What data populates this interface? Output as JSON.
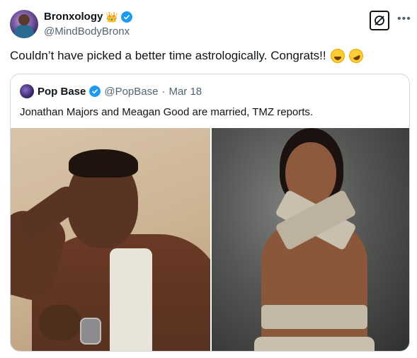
{
  "author": {
    "name": "Bronxology",
    "handle": "@MindBodyBronx",
    "crown_emoji": "👑",
    "verified": true
  },
  "tweet": {
    "text": "Couldn’t have picked a better time astrologically. Congrats!!",
    "emojis": [
      "grinning-sweat",
      "rolling-on-floor-laughing"
    ]
  },
  "quoted": {
    "name": "Pop Base",
    "handle": "@PopBase",
    "separator": "·",
    "date": "Mar 18",
    "verified": true,
    "text": "Jonathan Majors and Meagan Good are married, TMZ reports."
  },
  "colors": {
    "verified": "#1d9bf0",
    "text": "#0f1419",
    "secondary": "#536471",
    "border": "#cfd9de"
  }
}
